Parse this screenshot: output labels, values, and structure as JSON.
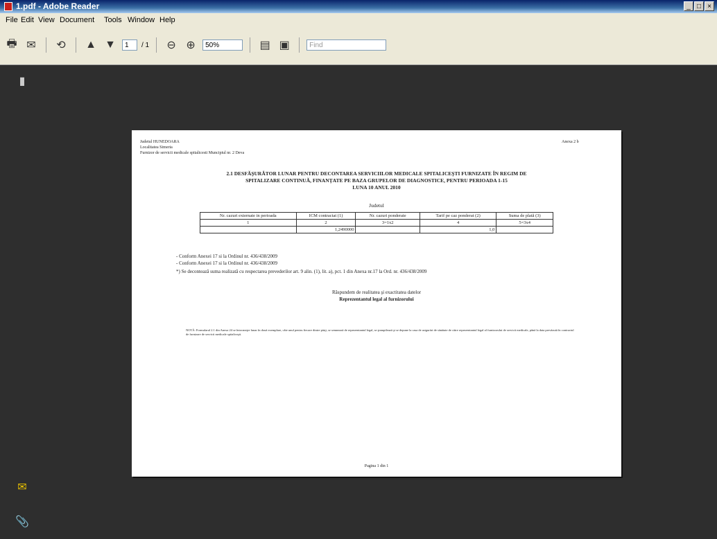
{
  "window": {
    "title": "1.pdf - Adobe Reader",
    "minimize": "_",
    "maximize": "□",
    "close": "×"
  },
  "menu": [
    "File",
    "Edit",
    "View",
    "Document",
    "Tools",
    "Window",
    "Help"
  ],
  "toolbar": {
    "page_current": "1",
    "page_total": "/ 1",
    "zoom": "50%",
    "find_placeholder": "Find"
  },
  "doc": {
    "header_left": [
      "Judetul HUNEDOARA",
      "Localitatea Simeria",
      "Furnizor de servicii medicale spitalicesti Muncipiul nr. 2 Deva"
    ],
    "header_right": "Anexa 2 b",
    "title_lines": [
      "2.1 DESFĂŞURĂTOR LUNAR PENTRU DECONTAREA SERVICIILOR MEDICALE SPITALICEŞTI FURNIZATE ÎN REGIM DE",
      "SPITALIZARE CONTINUĂ, FINANŢATE PE BAZA GRUPELOR DE DIAGNOSTICE, PENTRU PERIOADA 1-15",
      "LUNA 10 ANUL 2010"
    ],
    "subtitle": "Judetul",
    "table": {
      "headers": [
        "Nr. cazuri externate in perioada",
        "ICM contractat (1)",
        "Nr. cazuri ponderate",
        "Tarif pe caz ponderat (2)",
        "Suma de plată (3)"
      ],
      "row_index": [
        "1",
        "2",
        "3=1x2",
        "4",
        "5=3x4"
      ],
      "row_values": [
        "",
        "1,2490000",
        "",
        "1,0",
        ""
      ]
    },
    "notes": [
      "- Conform Anexei 17 si la Ordinul nr. 436/438/2009",
      "- Conform Anexei 17 si la Ordinul nr. 436/438/2009",
      "*) Se decontează suma realizată cu respectarea prevederilor art. 9 alin. (1), lit. a), pct. 1 din Anexa nr.17 la Ord. nr. 436/438/2009"
    ],
    "resp_1": "Răspundem de realitatea şi exactitatea datelor",
    "resp_2": "Reprezentantul legal al furnizorului",
    "footnote": "NOTĂ: Formularul 2.1 din Anexa 24 se întocmeşte lunar în două exemplare, câte unul pentru fiecare dintre părţi, se semnează de reprezentantul legal, se ştampilează şi se depune la casa de asigurări de sănătate de către reprezentantul legal al furnizorului de servicii medicale, până la data prevăzută în contractul de furnizare de servicii medicale spitaliceşti.",
    "page_number": "Pagina 1 din 1"
  }
}
